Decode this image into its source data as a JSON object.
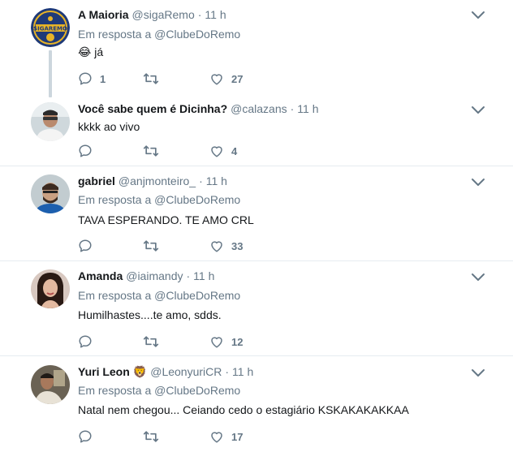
{
  "tweets": [
    {
      "name": "A Maioria",
      "handle": "@sigaRemo",
      "sep": "·",
      "time": "11 h",
      "reply_prefix": "Em resposta a",
      "reply_mention": "@ClubeDoRemo",
      "text": "já",
      "emoji": "😂",
      "replies": "1",
      "retweets": "",
      "likes": "27",
      "avatar_icon": "sigaremo-logo-icon",
      "avatar_text": "SIGAREMO"
    },
    {
      "name": "Você sabe quem é Dicinha?",
      "handle": "@calazans",
      "sep": "·",
      "time": "11 h",
      "text": "kkkk ao vivo",
      "replies": "",
      "retweets": "",
      "likes": "4"
    },
    {
      "name": "gabriel",
      "handle": "@anjmonteiro_",
      "sep": "·",
      "time": "11 h",
      "reply_prefix": "Em resposta a",
      "reply_mention": "@ClubeDoRemo",
      "text": "TAVA ESPERANDO. TE AMO CRL",
      "replies": "",
      "retweets": "",
      "likes": "33"
    },
    {
      "name": "Amanda",
      "handle": "@iaimandy",
      "sep": "·",
      "time": "11 h",
      "reply_prefix": "Em resposta a",
      "reply_mention": "@ClubeDoRemo",
      "text": "Humilhastes....te amo, sdds.",
      "replies": "",
      "retweets": "",
      "likes": "12"
    },
    {
      "name": "Yuri Leon",
      "name_emoji": "🦁",
      "handle": "@LeonyuriCR",
      "sep": "·",
      "time": "11 h",
      "reply_prefix": "Em resposta a",
      "reply_mention": "@ClubeDoRemo",
      "text": "Natal nem chegou... Ceiando cedo o estagiário KSKAKAKAKKAA",
      "replies": "",
      "retweets": "",
      "likes": "17"
    }
  ],
  "colors": {
    "text": "#14171a",
    "muted": "#657786",
    "divider": "#e6ecf0",
    "thread": "#ccd6dd",
    "sigaremo_blue": "#1f3a78",
    "sigaremo_gold": "#e8b427"
  }
}
